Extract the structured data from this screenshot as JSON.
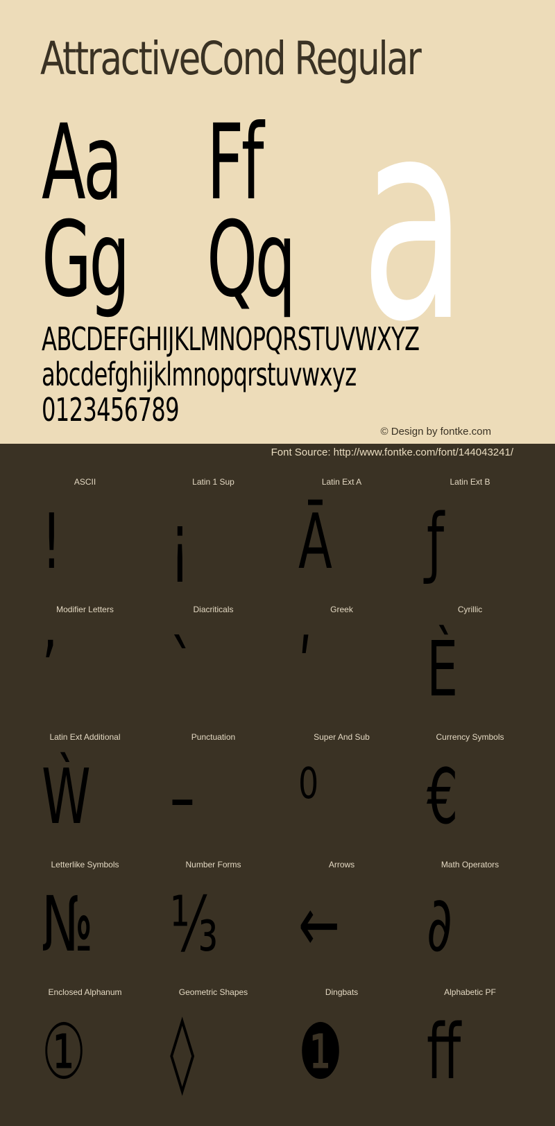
{
  "header": {
    "title": "AttractiveCond Regular"
  },
  "specimen": {
    "pair_row1": [
      "Aa",
      "Ff"
    ],
    "pair_row2": [
      "Gg",
      "Qq"
    ],
    "hero_glyph": "a",
    "uppercase": "ABCDEFGHIJKLMNOPQRSTUVWXYZ",
    "lowercase": "abcdefghijklmnopqrstuvwxyz",
    "digits": "0123456789"
  },
  "footer": {
    "credit": "© Design by fontke.com",
    "source": "Font Source: http://www.fontke.com/font/144043241/"
  },
  "colors": {
    "top_background": "#eddcb9",
    "bottom_background": "#3a3224",
    "hero_glyph": "#ffffff"
  },
  "charsets": [
    {
      "label": "ASCII",
      "glyph": "!"
    },
    {
      "label": "Latin 1 Sup",
      "glyph": "¡"
    },
    {
      "label": "Latin Ext A",
      "glyph": "Ā"
    },
    {
      "label": "Latin Ext B",
      "glyph": "ƒ"
    },
    {
      "label": "Modifier Letters",
      "glyph": "ʼ"
    },
    {
      "label": "Diacriticals",
      "glyph": "`"
    },
    {
      "label": "Greek",
      "glyph": "ʹ"
    },
    {
      "label": "Cyrillic",
      "glyph": "Ѐ"
    },
    {
      "label": "Latin Ext Additional",
      "glyph": "Ẁ"
    },
    {
      "label": "Punctuation",
      "glyph": "–"
    },
    {
      "label": "Super And Sub",
      "glyph": "⁰"
    },
    {
      "label": "Currency Symbols",
      "glyph": "€"
    },
    {
      "label": "Letterlike Symbols",
      "glyph": "№"
    },
    {
      "label": "Number Forms",
      "glyph": "⅓"
    },
    {
      "label": "Arrows",
      "glyph": "←"
    },
    {
      "label": "Math Operators",
      "glyph": "∂"
    },
    {
      "label": "Enclosed Alphanum",
      "glyph": "①"
    },
    {
      "label": "Geometric Shapes",
      "glyph": "◊"
    },
    {
      "label": "Dingbats",
      "glyph": "❶"
    },
    {
      "label": "Alphabetic PF",
      "glyph": "ﬀ"
    }
  ]
}
